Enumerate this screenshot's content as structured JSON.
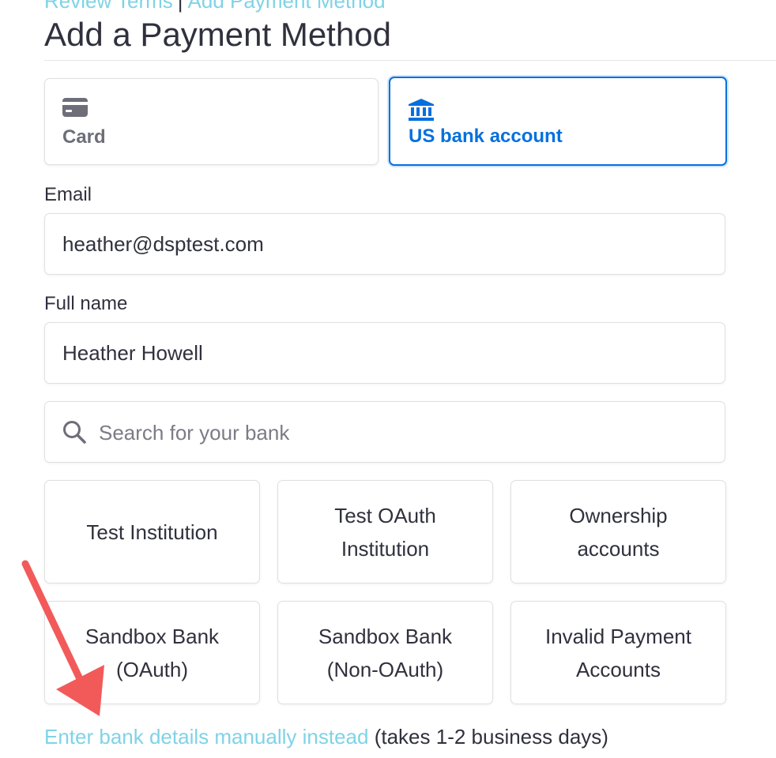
{
  "breadcrumb": {
    "parent": "Review Terms",
    "separator": "|",
    "current": "Add Payment Method"
  },
  "page_title": "Add a Payment Method",
  "payment_tabs": [
    {
      "label": "Card",
      "icon": "credit-card-icon",
      "selected": false
    },
    {
      "label": "US bank account",
      "icon": "bank-icon",
      "selected": true
    }
  ],
  "form": {
    "email_label": "Email",
    "email_value": "heather@dsptest.com",
    "name_label": "Full name",
    "name_value": "Heather Howell",
    "search_placeholder": "Search for your bank",
    "search_icon": "search-icon"
  },
  "banks": [
    "Test Institution",
    "Test OAuth Institution",
    "Ownership accounts",
    "Sandbox Bank (OAuth)",
    "Sandbox Bank (Non-OAuth)",
    "Invalid Payment Accounts"
  ],
  "footer": {
    "manual_link": "Enter bank details manually instead",
    "note": "(takes 1-2 business days)"
  },
  "colors": {
    "accent": "#0570de",
    "link": "#7fd3e6",
    "annotation_arrow": "#f25a5a"
  }
}
